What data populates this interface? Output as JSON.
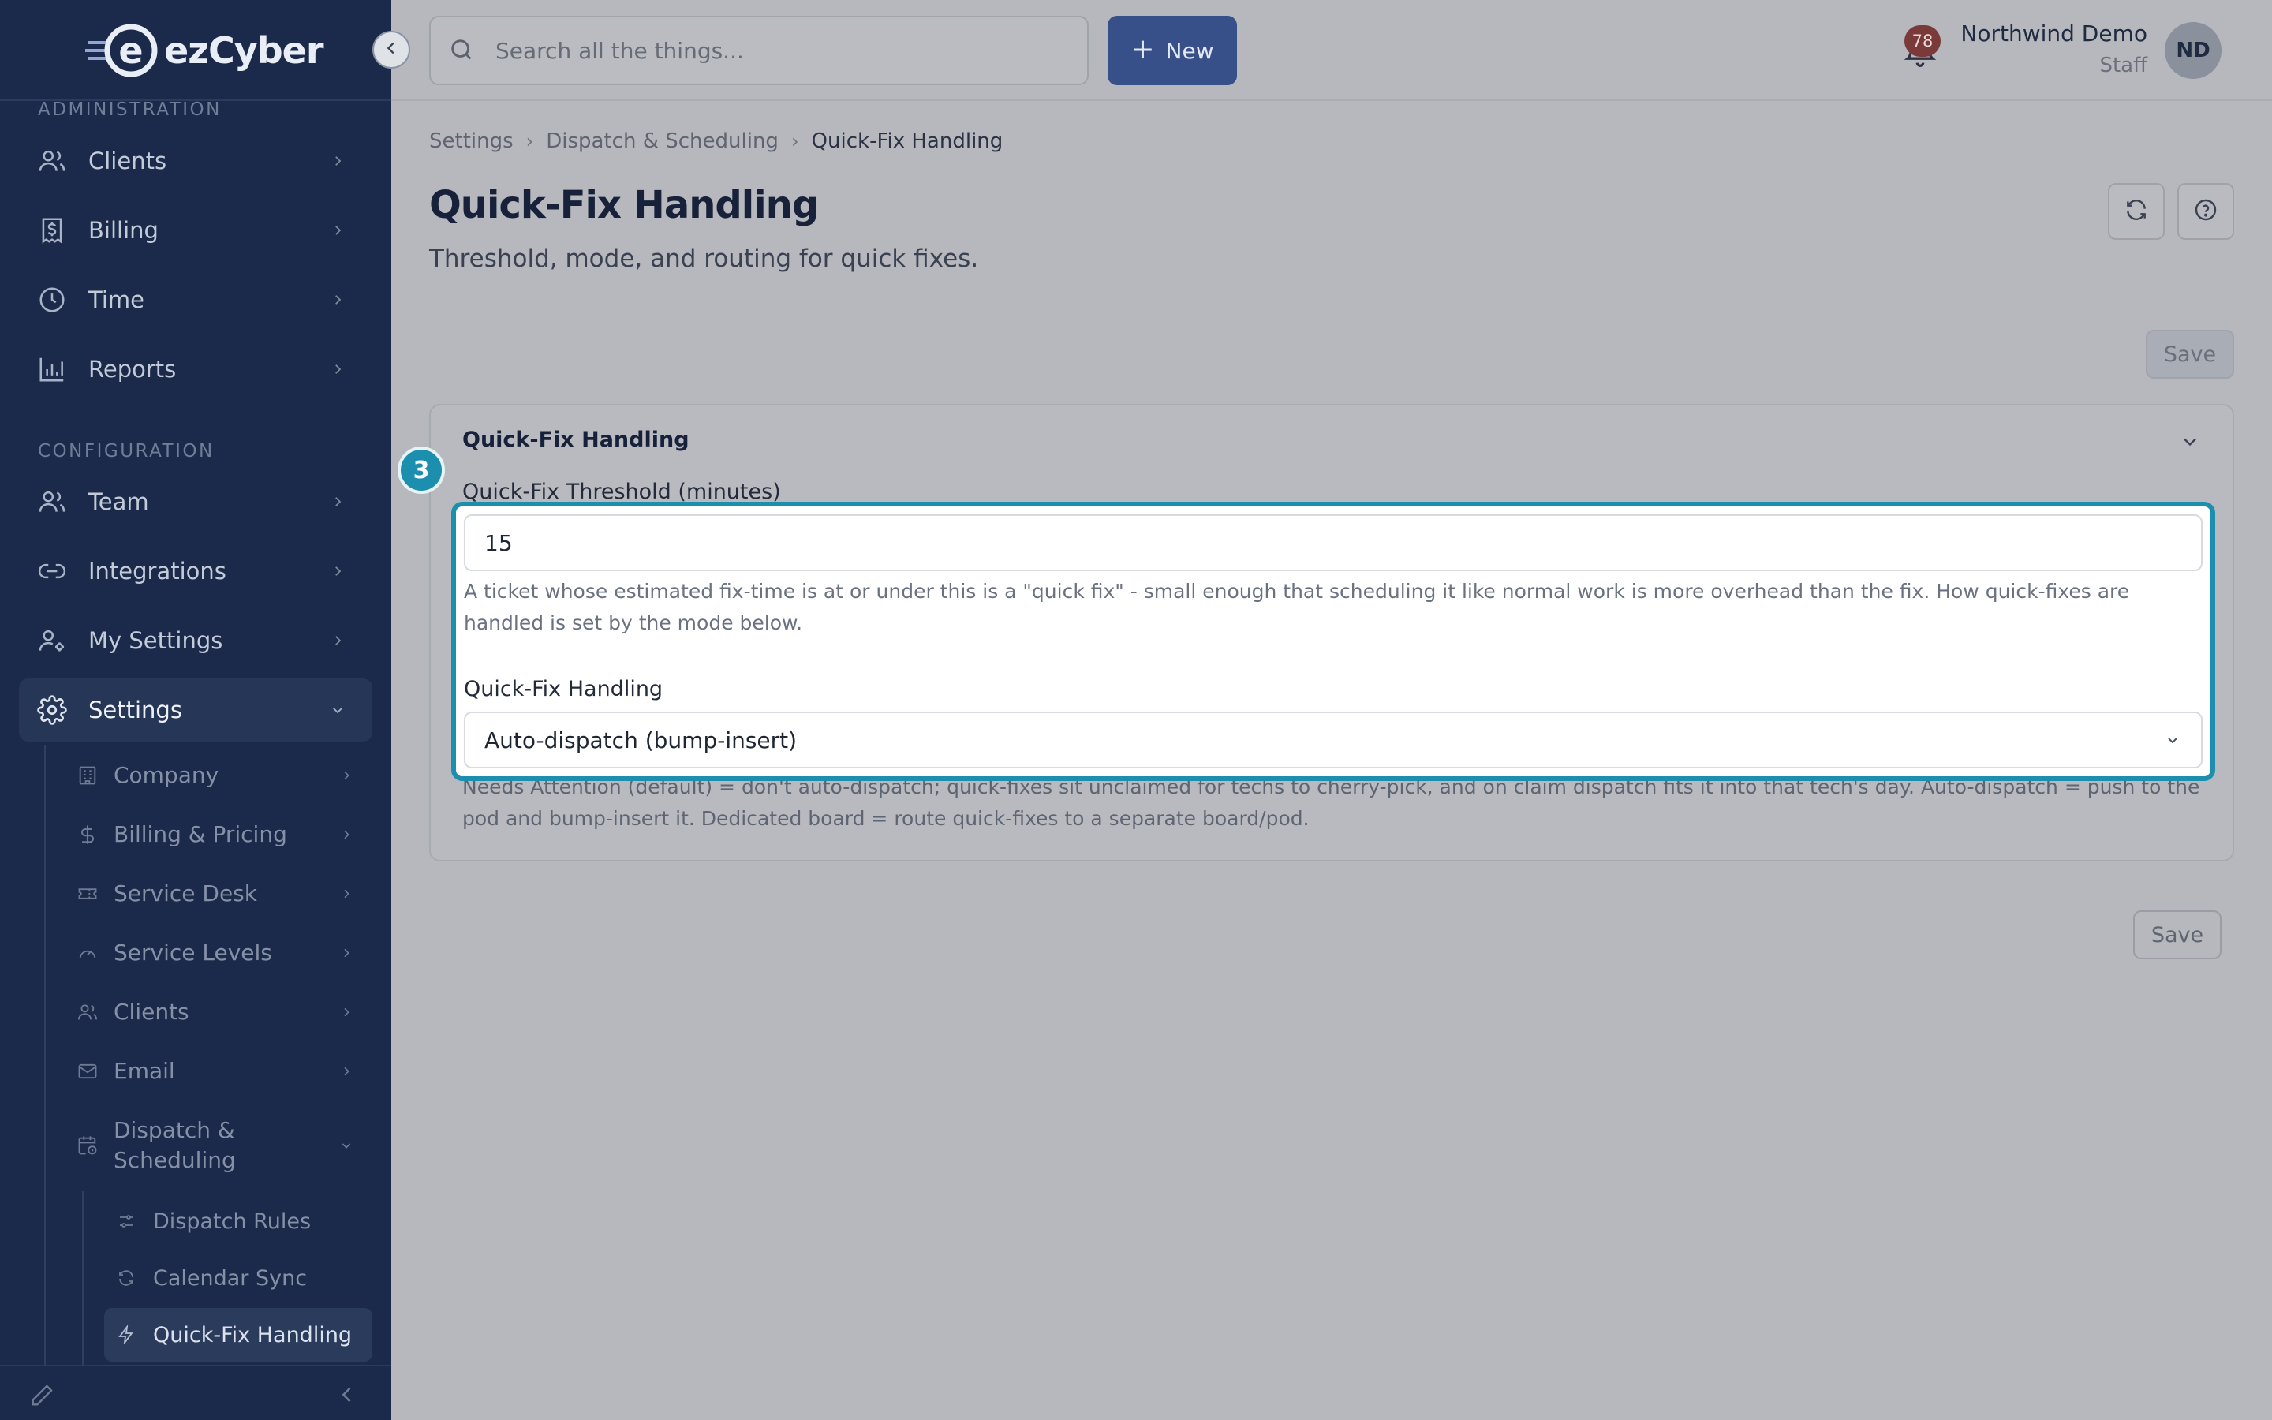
{
  "brand": {
    "name": "ezCyber",
    "logo_letter": "e"
  },
  "sidebar": {
    "sections": [
      {
        "label": "ADMINISTRATION"
      },
      {
        "label": "CONFIGURATION"
      }
    ],
    "admin_items": [
      {
        "label": "Clients",
        "icon": "users-icon"
      },
      {
        "label": "Billing",
        "icon": "receipt-icon"
      },
      {
        "label": "Time",
        "icon": "clock-icon"
      },
      {
        "label": "Reports",
        "icon": "bar-chart-icon"
      }
    ],
    "config_items": [
      {
        "label": "Team",
        "icon": "users-icon"
      },
      {
        "label": "Integrations",
        "icon": "link-icon"
      },
      {
        "label": "My Settings",
        "icon": "user-cog-icon"
      },
      {
        "label": "Settings",
        "icon": "gear-icon",
        "expanded": true
      }
    ],
    "settings_children": [
      {
        "label": "Company",
        "icon": "building-icon"
      },
      {
        "label": "Billing & Pricing",
        "icon": "dollar-icon"
      },
      {
        "label": "Service Desk",
        "icon": "ticket-icon"
      },
      {
        "label": "Service Levels",
        "icon": "gauge-icon"
      },
      {
        "label": "Clients",
        "icon": "users-icon"
      },
      {
        "label": "Email",
        "icon": "mail-icon"
      },
      {
        "label": "Dispatch & Scheduling",
        "icon": "calendar-clock-icon",
        "expanded": true
      }
    ],
    "dispatch_children": [
      {
        "label": "Dispatch Rules",
        "icon": "sliders-icon"
      },
      {
        "label": "Calendar Sync",
        "icon": "refresh-icon"
      },
      {
        "label": "Quick-Fix Handling",
        "icon": "bolt-icon",
        "active": true
      }
    ]
  },
  "topbar": {
    "search_placeholder": "Search all the things...",
    "new_label": "New",
    "notification_count": "78",
    "user_name": "Northwind Demo",
    "user_role": "Staff",
    "avatar_initials": "ND"
  },
  "main": {
    "breadcrumb": [
      "Settings",
      "Dispatch & Scheduling",
      "Quick-Fix Handling"
    ],
    "title": "Quick-Fix Handling",
    "subtitle": "Threshold, mode, and routing for quick fixes.",
    "save_label": "Save",
    "card": {
      "title": "Quick-Fix Handling",
      "threshold_label": "Quick-Fix Threshold (minutes)",
      "threshold_value": "15",
      "threshold_help": "A ticket whose estimated fix-time is at or under this is a \"quick fix\" - small enough that scheduling it like normal work is more overhead than the fix. How quick-fixes are handled is set by the mode below.",
      "handling_label": "Quick-Fix Handling",
      "handling_value": "Auto-dispatch (bump-insert)",
      "handling_help": "Needs Attention (default) = don't auto-dispatch; quick-fixes sit unclaimed for techs to cherry-pick, and on claim dispatch fits it into that tech's day. Auto-dispatch = push to the pod and bump-insert it. Dedicated board = route quick-fixes to a separate board/pod."
    }
  },
  "overlay": {
    "step_number": "3",
    "highlight_color": "#1c8fae"
  },
  "colors": {
    "sidebar_bg": "#1b2a4a",
    "accent": "#37508a",
    "highlight": "#1c8fae",
    "badge": "#7a3a3a"
  }
}
